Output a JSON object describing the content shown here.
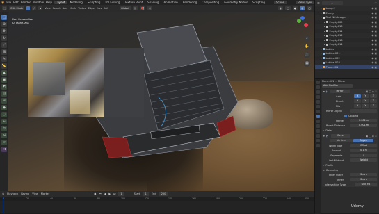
{
  "menu": {
    "items": [
      "File",
      "Edit",
      "Render",
      "Window",
      "Help"
    ],
    "workspaces": [
      "Layout",
      "Modeling",
      "Sculpting",
      "UV Editing",
      "Texture Paint",
      "Shading",
      "Animation",
      "Rendering",
      "Compositing",
      "Geometry Nodes",
      "Scripting"
    ],
    "active_workspace": "Layout",
    "scene": "Scene",
    "view_layer": "ViewLayer"
  },
  "viewport_header": {
    "mode": "Edit Mode",
    "menus": [
      "View",
      "Select",
      "Add",
      "Mesh",
      "Vertex",
      "Edge",
      "Face",
      "UV"
    ],
    "transform": "Global"
  },
  "viewport": {
    "view_name": "User Perspective",
    "object_name": "(0) Plane.001"
  },
  "timeline": {
    "menus": [
      "Playback",
      "Keying",
      "View",
      "Marker"
    ],
    "start_label": "Start",
    "start": "1",
    "end_label": "End",
    "end": "250",
    "current_frame": "1",
    "ruler": [
      "0",
      "20",
      "40",
      "60",
      "80",
      "100",
      "120",
      "140",
      "160",
      "180",
      "200",
      "220",
      "240",
      "250"
    ]
  },
  "outliner": {
    "rows": [
      {
        "name": "Lamp.2",
        "indent": 1,
        "color": "#e0a060"
      },
      {
        "name": "Empty",
        "indent": 1,
        "color": "#c0c0c0"
      },
      {
        "name": "Real Nth Images",
        "indent": 1,
        "color": "#d8d8d8"
      },
      {
        "name": "Empty.009",
        "indent": 2,
        "color": "#c0c0c0"
      },
      {
        "name": "Empty.010",
        "indent": 2,
        "color": "#c0c0c0"
      },
      {
        "name": "Empty.011",
        "indent": 2,
        "color": "#c0c0c0"
      },
      {
        "name": "Empty.012",
        "indent": 2,
        "color": "#c0c0c0"
      },
      {
        "name": "Empty.013",
        "indent": 2,
        "color": "#c0c0c0"
      },
      {
        "name": "Empty.014",
        "indent": 2,
        "color": "#c0c0c0"
      },
      {
        "name": "Lattice",
        "indent": 1,
        "color": "#a0c0e0"
      },
      {
        "name": "Lattice.001",
        "indent": 1,
        "color": "#a0c0e0"
      },
      {
        "name": "Lattice.002",
        "indent": 1,
        "color": "#a0c0e0"
      },
      {
        "name": "Lattice.003",
        "indent": 1,
        "color": "#a0c0e0"
      },
      {
        "name": "Plane.001",
        "indent": 1,
        "color": "#f0a040"
      }
    ]
  },
  "properties": {
    "object_name": "Plane.001",
    "modifier_label": "Mirror",
    "add_modifier": "Add Modifier",
    "mirror": {
      "name": "Mirror",
      "axis_label": "Axis",
      "bisect_label": "Bisect",
      "flip_label": "Flip",
      "axes": [
        "X",
        "Y",
        "Z"
      ],
      "mirror_object_label": "Mirror Object",
      "clipping_label": "Clipping",
      "merge_label": "Merge",
      "merge_value": "0.001 m",
      "bisect_distance_label": "Bisect Distance",
      "bisect_distance_value": "0.001 m",
      "data_label": "Data"
    },
    "bevel": {
      "name": "Bevel",
      "tab_vertices": "Vertices",
      "tab_edges": "Edges",
      "width_type_label": "Width Type",
      "width_type_value": "Offset",
      "amount_label": "Amount",
      "amount_value": "0.1 m",
      "segments_label": "Segments",
      "segments_value": "1",
      "limit_method_label": "Limit Method",
      "limit_method_value": "Weight",
      "profile_label": "Profile",
      "geometry_label": "Geometry",
      "miter_outer_label": "Miter Outer",
      "miter_outer_value": "Sharp",
      "inner_label": "Inner",
      "inner_value": "Sharp",
      "intersection_label": "Intersection Type",
      "intersection_value": "Grid Fill"
    }
  },
  "watermark": "Udemy"
}
